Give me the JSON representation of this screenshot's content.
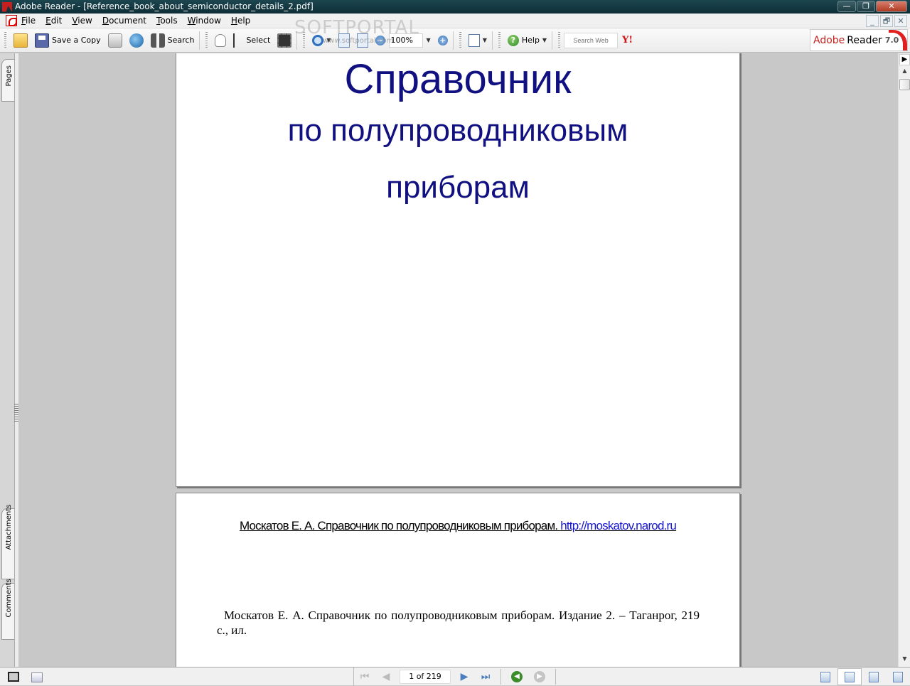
{
  "window": {
    "title": "Adobe Reader - [Reference_book_about_semiconductor_details_2.pdf]",
    "controls": {
      "minimize": "—",
      "restore": "❐",
      "close": "✕"
    },
    "doc_controls": {
      "minimize": "_",
      "restore": "🗗",
      "close": "✕"
    }
  },
  "menu": {
    "items": [
      "File",
      "Edit",
      "View",
      "Document",
      "Tools",
      "Window",
      "Help"
    ]
  },
  "toolbar": {
    "save_copy_label": "Save a Copy",
    "search_label": "Search",
    "select_label": "Select",
    "zoom_value": "100%",
    "help_label": "Help",
    "search_web_placeholder": "Search Web",
    "yahoo_label": "Y!",
    "brand": {
      "adobe": "Adobe",
      "reader": "Reader",
      "version": "7.0"
    }
  },
  "watermark": {
    "text": "SOFTPORTAL",
    "url": "www.softportal.com"
  },
  "nav_panel": {
    "tabs": [
      "Pages",
      "Attachments",
      "Comments"
    ]
  },
  "document": {
    "page1": {
      "title": "Справочник",
      "subtitle_line1": "по полупроводниковым",
      "subtitle_line2": "приборам"
    },
    "page2": {
      "header_text": "Москатов Е. А. Справочник по полупроводниковым приборам. ",
      "header_link": "http://moskatov.narod.ru",
      "citation": "Москатов Е. А. Справочник по полупроводниковым приборам. Издание 2. – Таганрог, 219 с., ил."
    }
  },
  "statusbar": {
    "page_indicator": "1 of 219",
    "current_page": 1,
    "total_pages": 219
  }
}
